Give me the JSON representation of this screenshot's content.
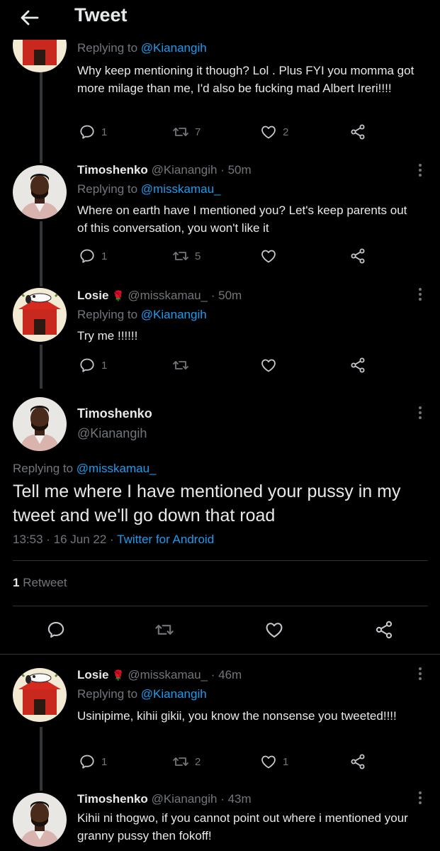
{
  "header": {
    "title": "Tweet"
  },
  "tweets": [
    {
      "replying_prefix": "Replying to",
      "replying_to": "@Kianangih",
      "text": "Why keep mentioning it though? Lol . Plus FYI you momma got more milage than me, I'd also be fucking mad Albert Ireri!!!!",
      "replies": "1",
      "retweets": "7",
      "likes": "2"
    },
    {
      "name": "Timoshenko",
      "handle": "@Kianangih",
      "time": "· 50m",
      "replying_prefix": "Replying to",
      "replying_to": "@misskamau_",
      "text": "Where on earth have I mentioned you? Let's keep parents out of this conversation, you won't like it",
      "replies": "1",
      "retweets": "5",
      "likes": ""
    },
    {
      "name": "Losie",
      "handle": "@misskamau_",
      "time": "· 50m",
      "replying_prefix": "Replying to",
      "replying_to": "@Kianangih",
      "text": "Try me !!!!!!",
      "replies": "1",
      "retweets": "",
      "likes": ""
    }
  ],
  "main_tweet": {
    "name": "Timoshenko",
    "handle": "@Kianangih",
    "replying_prefix": "Replying to",
    "replying_to": "@misskamau_",
    "text": "Tell me where I have mentioned your pussy in my tweet and we'll go down that road",
    "time": "13:53 · 16 Jun 22 ·",
    "source": "Twitter for Android",
    "retweet_count": "1",
    "retweet_label": "Retweet"
  },
  "replies_below": [
    {
      "name": "Losie",
      "handle": "@misskamau_",
      "time": "· 46m",
      "replying_prefix": "Replying to",
      "replying_to": "@Kianangih",
      "text": "Usinipime,  kihii gikii,  you know the nonsense you tweeted!!!!",
      "replies": "1",
      "retweets": "2",
      "likes": "1"
    },
    {
      "name": "Timoshenko",
      "handle": "@Kianangih",
      "time": "· 43m",
      "text": "Kihii ni thogwo, if you cannot point out where i mentioned your granny pussy then fokoff!"
    }
  ],
  "colors": {
    "background": "#000000",
    "text": "#e7e9ea",
    "muted": "#71767b",
    "link": "#1d9bf0",
    "divider": "#2f3336"
  },
  "icons": [
    "back-arrow-icon",
    "reply-icon",
    "retweet-icon",
    "like-icon",
    "share-icon",
    "more-icon",
    "rose-icon"
  ]
}
